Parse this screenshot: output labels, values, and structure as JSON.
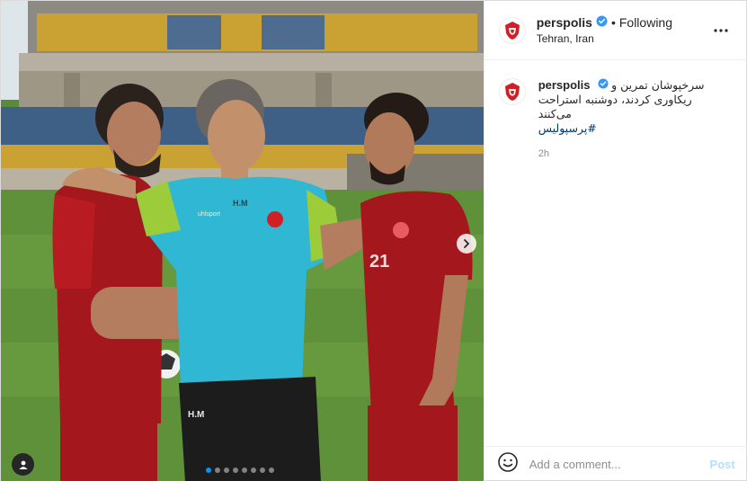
{
  "post": {
    "username": "perspolis",
    "follow_separator": "•",
    "follow_label": "Following",
    "location": "Tehran, Iran",
    "caption_text": "سرخپوشان تمرین و ریکاوری کردند، دوشنبه استراحت می‌کنند",
    "hashtag": "#پرسپولیس",
    "time": "2h"
  },
  "comment": {
    "placeholder": "Add a comment...",
    "post_label": "Post"
  },
  "carousel": {
    "slide_count": 8,
    "active_slide": 1
  },
  "icons": {
    "verified": "verified-badge-icon",
    "more": "more-options-icon",
    "next": "chevron-right-icon",
    "tag": "user-tag-icon",
    "emoji": "emoji-icon"
  },
  "colors": {
    "verified": "#3897f0",
    "accent": "#0095f6",
    "post_disabled": "#b2dffc",
    "club_red": "#d11f26"
  },
  "photo": {
    "shirt_text_center": "H.M",
    "shirt_brand": "uhlsport",
    "short_text": "H.M",
    "player_number": "21"
  }
}
